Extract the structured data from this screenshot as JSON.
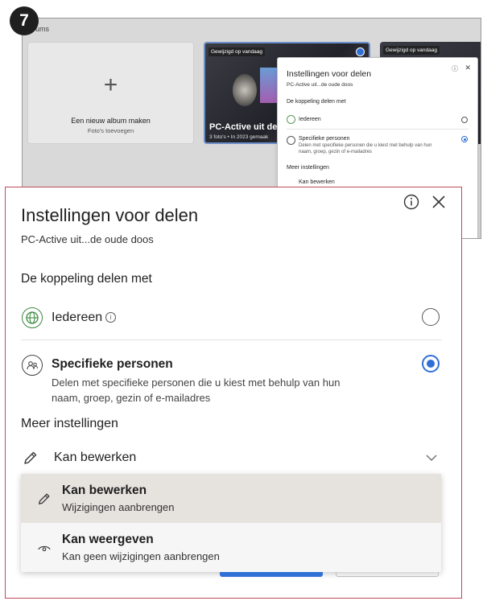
{
  "step": {
    "number": "7"
  },
  "background": {
    "albums_label": "ums",
    "new_album": {
      "title": "Een nieuw album maken",
      "subtitle": "Foto's toevoegen"
    },
    "album": {
      "badge": "Gewijzigd op vandaag",
      "title": "PC-Active uit de",
      "meta": "3 foto's • In 2023 gemaak"
    },
    "album3_badge": "Gewijzigd op vandaag",
    "mini_panel": {
      "title": "Instellingen voor delen",
      "subtitle": "PC-Active uit...de oude doos",
      "share_heading": "De koppeling delen met",
      "everyone": "Iedereen",
      "specific_title": "Specifieke personen",
      "specific_desc_1": "Delen met specifieke personen die u kiest met behulp van hun",
      "specific_desc_2": "naam, groep, gezin of e-mailadres",
      "more": "Meer instellingen",
      "permission": "Kan bewerken"
    }
  },
  "panel": {
    "title": "Instellingen voor delen",
    "subtitle": "PC-Active uit...de oude doos",
    "share_heading": "De koppeling delen met",
    "options": {
      "everyone": {
        "label": "Iedereen",
        "selected": false
      },
      "specific": {
        "label": "Specifieke personen",
        "desc_1": "Delen met specifieke personen die u kiest met behulp van hun",
        "desc_2": "naam, groep, gezin of e-mailadres",
        "selected": true
      }
    },
    "more_heading": "Meer instellingen",
    "permission": {
      "current": "Kan bewerken"
    },
    "dropdown": [
      {
        "title": "Kan bewerken",
        "desc": "Wijzigingen aanbrengen",
        "icon": "pencil-icon"
      },
      {
        "title": "Kan weergeven",
        "desc": "Kan geen wijzigingen aanbrengen",
        "icon": "eye-icon"
      }
    ]
  },
  "colors": {
    "accent": "#2f6fd6",
    "frame": "#c04a5b",
    "globe": "#3b8a3e"
  }
}
